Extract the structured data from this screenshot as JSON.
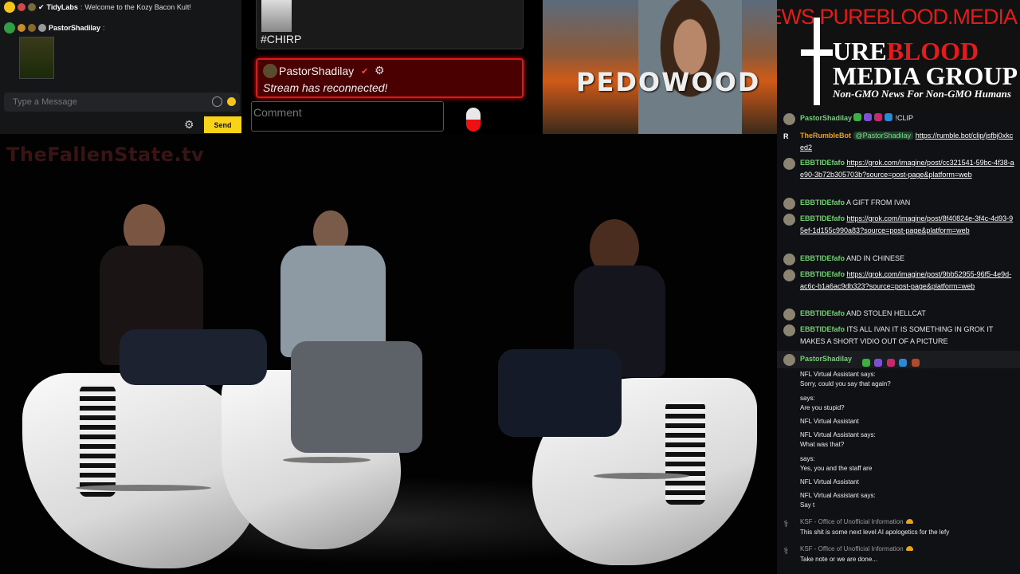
{
  "colors": {
    "accent_yellow": "#f9d317",
    "alert_red": "#e01818",
    "username_green": "#6fd36f",
    "brand_red": "#e31b1b"
  },
  "popout": {
    "line1": {
      "user": "TidyLabs",
      "sep": " : ",
      "text": "Welcome to the Kozy Bacon Kult!"
    },
    "line2": {
      "user": "PastorShadilay",
      "sep": " :"
    },
    "input_placeholder": "Type a Message",
    "send_label": "Send"
  },
  "mid": {
    "chirp_tag": "#CHIRP",
    "alert": {
      "user": "PastorShadilay",
      "check": "✔",
      "message": "Stream has reconnected!"
    },
    "comment_placeholder": "Comment"
  },
  "banner": {
    "text": "PEDOWOOD"
  },
  "logo": {
    "url": "NEWS.PUREBLOOD.MEDIA",
    "line1_a": "URE",
    "line1_b": "BLOOD",
    "line2": "MEDIA GROUP",
    "tagline": "Non-GMO News For Non-GMO Humans"
  },
  "video": {
    "watermark": "TheFallenState.tv"
  },
  "chat": {
    "messages": [
      {
        "user": "PastorShadilay",
        "user_color": "#6fd36f",
        "text": "!CLIP"
      },
      {
        "user": "TheRumbleBot",
        "user_color": "#e8a317",
        "mention": "@PastorShadilay",
        "link": "https://rumble.bot/clip/jsfbj0xkced2"
      },
      {
        "user": "EBBTIDEfafo",
        "user_color": "#6fd36f",
        "link": "https://grok.com/imagine/post/cc321541-59bc-4f38-ae90-3b72b305703b?source=post-page&platform=web"
      },
      {
        "user": "EBBTIDEfafo",
        "user_color": "#6fd36f",
        "text": "A GIFT FROM IVAN"
      },
      {
        "user": "EBBTIDEfafo",
        "user_color": "#6fd36f",
        "link": "https://grok.com/imagine/post/8f40824e-3f4c-4d93-95ef-1d155c990a83?source=post-page&platform=web"
      },
      {
        "user": "EBBTIDEfafo",
        "user_color": "#6fd36f",
        "text": "AND IN CHINESE"
      },
      {
        "user": "EBBTIDEfafo",
        "user_color": "#6fd36f",
        "link": "https://grok.com/imagine/post/9bb52955-96f5-4e9d-ac6c-b1a6ac9db323?source=post-page&platform=web"
      },
      {
        "user": "EBBTIDEfafo",
        "user_color": "#6fd36f",
        "text": "AND STOLEN HELLCAT"
      },
      {
        "user": "EBBTIDEfafo",
        "user_color": "#6fd36f",
        "text": "ITS ALL IVAN IT IS SOMETHING IN GROK IT MAKES A SHORT VIDIO OUT OF A PICTURE"
      }
    ],
    "pinned_user": "PastorShadilay"
  },
  "chat2": {
    "lines": [
      "NFL Virtual Assistant says:",
      "Sorry, could you say that again?",
      "says:",
      "Are you stupid?",
      "NFL Virtual Assistant",
      "NFL Virtual Assistant says:",
      "What was that?",
      "says:",
      "Yes, you and the staff are",
      "NFL Virtual Assistant",
      "NFL Virtual Assistant says:",
      "Say t"
    ],
    "ksf": [
      {
        "name": "KSF - Office of Unofficial Information",
        "text": "This shit is some next level AI apologetics for the lefy"
      },
      {
        "name": "KSF - Office of Unofficial Information",
        "text": "Take note or we are done..."
      }
    ]
  }
}
